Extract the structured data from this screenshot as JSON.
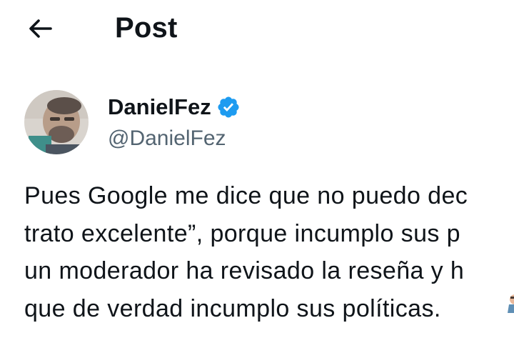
{
  "header": {
    "title": "Post"
  },
  "author": {
    "display_name": "DanielFez",
    "handle": "@DanielFez",
    "verified": true
  },
  "post": {
    "lines": [
      "Pues Google me dice que no puedo dec",
      "trato excelente”, porque incumplo sus p",
      "un moderador ha revisado la reseña y h",
      "que de verdad incumplo sus políticas."
    ]
  },
  "colors": {
    "text_primary": "#0f1419",
    "text_secondary": "#536471",
    "verified_blue": "#1d9bf0",
    "background": "#ffffff"
  },
  "icons": {
    "back": "arrow-left-icon",
    "verified": "verified-badge-icon"
  }
}
